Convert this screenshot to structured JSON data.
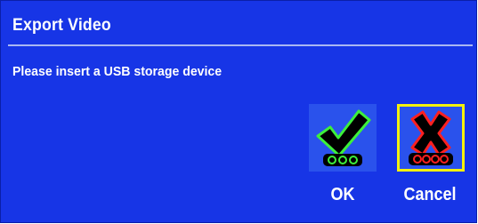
{
  "dialog": {
    "title": "Export Video",
    "message": "Please insert a USB storage device"
  },
  "buttons": {
    "ok": {
      "label": "OK",
      "icon": "checkmark-icon",
      "focused": false
    },
    "cancel": {
      "label": "Cancel",
      "icon": "cross-icon",
      "focused": true
    }
  },
  "colors": {
    "background": "#1735e6",
    "button_bg": "#2a52ec",
    "focus_border": "#f4f10c",
    "ok_accent": "#3df03a",
    "cancel_accent": "#ff2020",
    "text": "#ffffff"
  }
}
